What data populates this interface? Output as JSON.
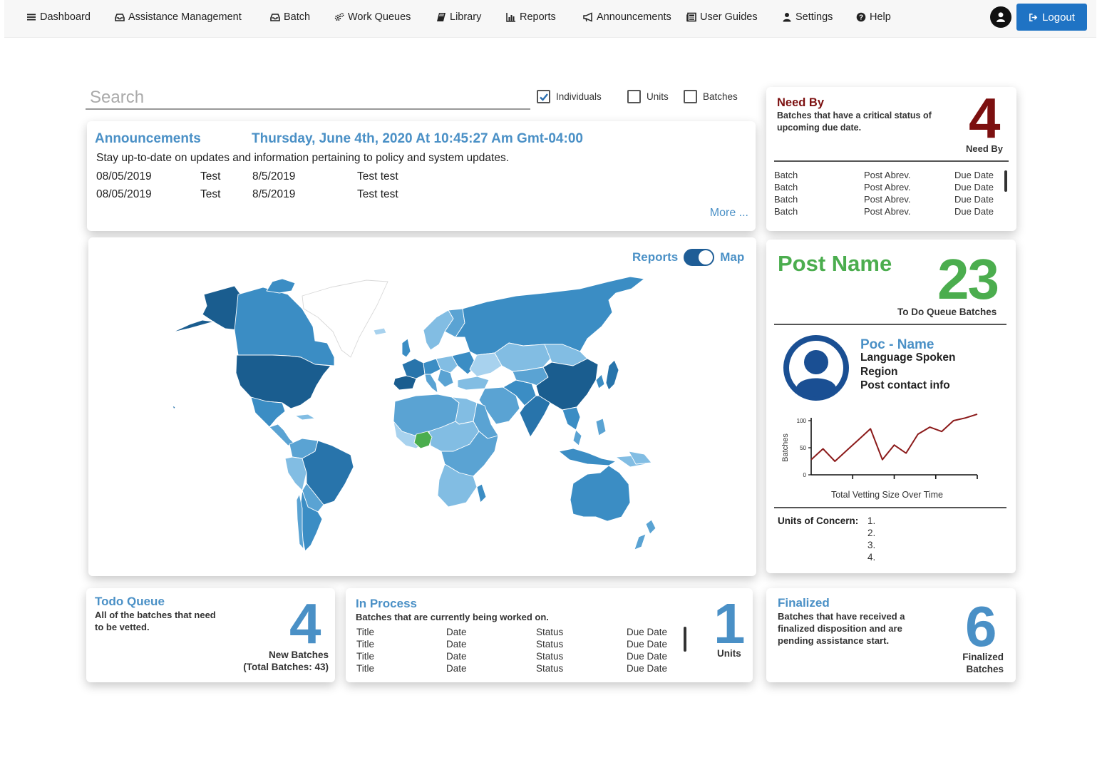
{
  "nav": {
    "items": [
      {
        "label": "Dashboard",
        "icon": "hamburger-icon"
      },
      {
        "label": "Assistance Management",
        "icon": "inbox-icon"
      },
      {
        "label": "Batch",
        "icon": "inbox-icon"
      },
      {
        "label": "Work Queues",
        "icon": "cogs-icon"
      },
      {
        "label": "Library",
        "icon": "book-icon"
      },
      {
        "label": "Reports",
        "icon": "bar-chart-icon"
      },
      {
        "label": "Announcements",
        "icon": "bullhorn-icon"
      },
      {
        "label": "User Guides",
        "icon": "newspaper-icon"
      },
      {
        "label": "Settings",
        "icon": "user-icon"
      },
      {
        "label": "Help",
        "icon": "question-circle-icon"
      }
    ],
    "logout_label": "Logout"
  },
  "search": {
    "placeholder": "Search",
    "filters": [
      {
        "label": "Individuals",
        "checked": true
      },
      {
        "label": "Units",
        "checked": false
      },
      {
        "label": "Batches",
        "checked": false
      }
    ]
  },
  "announcements": {
    "title": "Announcements",
    "datetime": "Thursday, June 4th, 2020 At 10:45:27 Am Gmt-04:00",
    "description": "Stay up-to-date on updates and information pertaining to policy and system updates.",
    "rows": [
      [
        "08/05/2019",
        "Test",
        "8/5/2019",
        "Test test"
      ],
      [
        "08/05/2019",
        "Test",
        "8/5/2019",
        "Test test"
      ]
    ],
    "more_label": "More ..."
  },
  "need_by": {
    "title": "Need By",
    "description": "Batches that have a critical status of upcoming due date.",
    "count": "4",
    "count_label": "Need By",
    "rows": [
      [
        "Batch",
        "Post Abrev.",
        "Due Date"
      ],
      [
        "Batch",
        "Post Abrev.",
        "Due Date"
      ],
      [
        "Batch",
        "Post Abrev.",
        "Due Date"
      ],
      [
        "Batch",
        "Post Abrev.",
        "Due Date"
      ]
    ]
  },
  "map": {
    "toggle_left": "Reports",
    "toggle_right": "Map",
    "toggle_on": true,
    "highlight_color": "#4bad4e",
    "palette": [
      "#a8d2ee",
      "#82bde3",
      "#5aa3d3",
      "#3b8dc4",
      "#2874ab",
      "#1a5d8f"
    ]
  },
  "post": {
    "name": "Post Name",
    "count": "23",
    "count_label": "To Do Queue Batches",
    "poc_name": "Poc - Name",
    "poc_lines": [
      "Language Spoken",
      "Region",
      "Post contact info"
    ],
    "units_label": "Units of Concern:",
    "units_items": [
      "1.",
      "2.",
      "3.",
      "4."
    ]
  },
  "chart_data": {
    "type": "line",
    "title": "",
    "xlabel": "Total Vetting Size Over Time",
    "ylabel": "Batches",
    "ylim": [
      0,
      100
    ],
    "yticks": [
      0,
      50,
      100
    ],
    "x": [
      0,
      1,
      2,
      3,
      4,
      5,
      6,
      7,
      8,
      9,
      10,
      11,
      12,
      13,
      14
    ],
    "series": [
      {
        "values": [
          28,
          48,
          25,
          45,
          65,
          85,
          28,
          55,
          40,
          75,
          88,
          80,
          100,
          105,
          112
        ]
      }
    ],
    "line_color": "#8b1a1a",
    "grid": false
  },
  "todo": {
    "title": "Todo Queue",
    "description": "All of the batches that need to be vetted.",
    "count": "4",
    "label_line1": "New Batches",
    "label_line2": "(Total Batches: 43)"
  },
  "in_process": {
    "title": "In Process",
    "description": "Batches that are currently being worked on.",
    "rows": [
      [
        "Title",
        "Date",
        "Status",
        "Due Date"
      ],
      [
        "Title",
        "Date",
        "Status",
        "Due Date"
      ],
      [
        "Title",
        "Date",
        "Status",
        "Due Date"
      ],
      [
        "Title",
        "Date",
        "Status",
        "Due Date"
      ]
    ],
    "count": "1",
    "count_label": "Units"
  },
  "finalized": {
    "title": "Finalized",
    "description": "Batches that have received a finalized disposition and are pending assistance start.",
    "count": "6",
    "label_line1": "Finalized",
    "label_line2": "Batches"
  }
}
